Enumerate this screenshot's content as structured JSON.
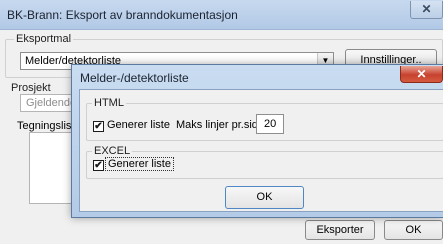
{
  "main": {
    "title": "BK-Brann: Eksport av branndokumentasjon",
    "close_glyph": "✕",
    "eksport_group_label": "Eksportmal",
    "layout_selected": "Melder/detektorliste",
    "settings_button": "Innstillinger..",
    "prosjekt_label": "Prosjekt",
    "prosjekt_value": "Gjeldende",
    "tegning_label": "Tegningslis",
    "export_button": "Eksporter",
    "ok_button": "OK"
  },
  "dialog": {
    "title": "Melder-/detektorliste",
    "close_glyph": "✕",
    "html_group_label": "HTML",
    "html_generate_label": "Generer liste",
    "html_generate_checked": true,
    "max_lines_label": "Maks linjer pr.side:",
    "max_lines_value": "20",
    "excel_group_label": "EXCEL",
    "excel_generate_label": "Generer liste",
    "excel_generate_checked": true,
    "ok_button": "OK"
  },
  "icons": {
    "checkmark": "✔",
    "dropdown_arrow": "▼"
  }
}
